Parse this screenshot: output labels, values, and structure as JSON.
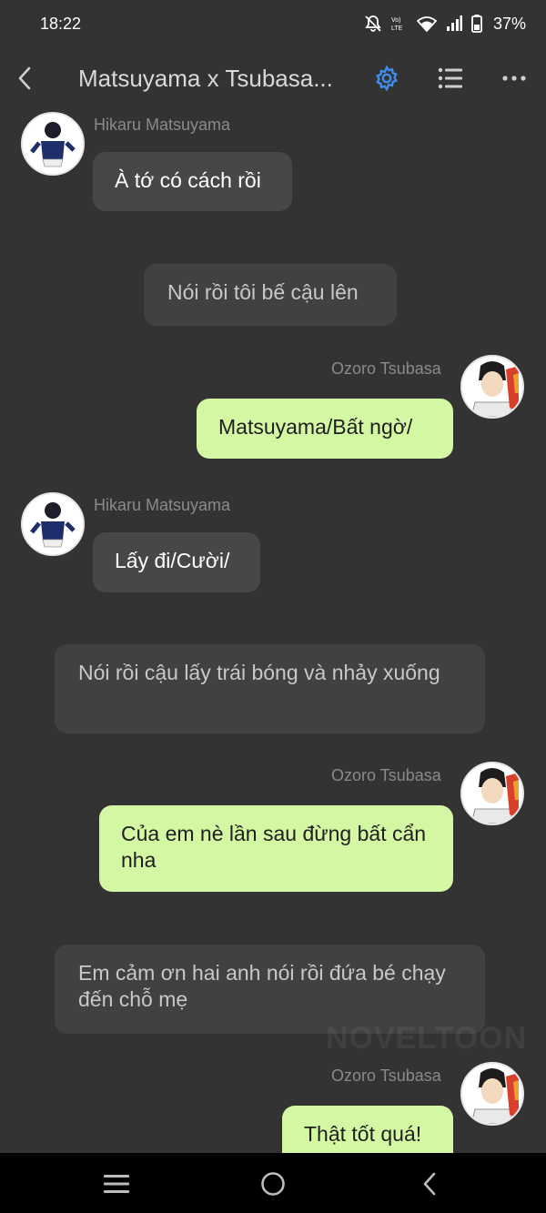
{
  "status_bar": {
    "time": "18:22",
    "battery": "37%",
    "icons": [
      "mute-icon",
      "volte-icon",
      "wifi-icon",
      "signal-icon",
      "battery-icon"
    ]
  },
  "header": {
    "title": "Matsuyama x Tsubasa...",
    "icons": [
      "back-arrow-icon",
      "settings-gear-icon",
      "list-menu-icon",
      "more-options-icon"
    ],
    "accent_color": "#3d8ef0"
  },
  "messages": [
    {
      "kind": "incoming",
      "sender": "Hikaru Matsuyama",
      "text": "À tớ có cách rồi"
    },
    {
      "kind": "narration",
      "text": "Nói rồi tôi bế cậu lên"
    },
    {
      "kind": "outgoing",
      "sender": "Ozoro Tsubasa",
      "text": "Matsuyama/Bất ngờ/"
    },
    {
      "kind": "incoming",
      "sender": "Hikaru Matsuyama",
      "text": "Lấy đi/Cười/"
    },
    {
      "kind": "narration",
      "text": "Nói rồi cậu lấy trái bóng và nhảy xuống"
    },
    {
      "kind": "outgoing",
      "sender": "Ozoro Tsubasa",
      "text": "Của em nè lần sau đừng bất cẩn nha"
    },
    {
      "kind": "narration",
      "text": "Em cảm ơn hai anh nói rồi đứa bé chạy đến chỗ mẹ"
    },
    {
      "kind": "outgoing",
      "sender": "Ozoro Tsubasa",
      "text": "Thật tốt quá!"
    }
  ],
  "watermark": "NOVELTOON",
  "colors": {
    "background": "#333333",
    "incoming_bubble": "#474747",
    "outgoing_bubble": "#d4f7a3",
    "narration_bubble": "#414141"
  },
  "nav_bar": {
    "icons": [
      "recents-icon",
      "home-icon",
      "back-icon"
    ]
  }
}
